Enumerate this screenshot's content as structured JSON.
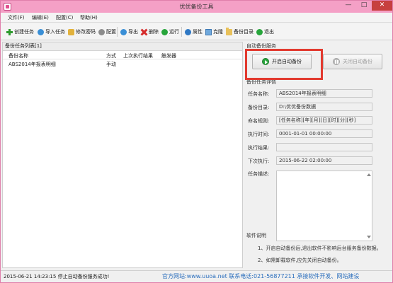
{
  "window": {
    "title": "优优备份工具",
    "min": "—",
    "max": "□",
    "close": "✕"
  },
  "menu": [
    {
      "label": "文件(F)"
    },
    {
      "label": "编辑(E)"
    },
    {
      "label": "配置(C)"
    },
    {
      "label": "帮助(H)"
    }
  ],
  "toolbar": [
    {
      "label": "创建任务",
      "icon": "plus-icon"
    },
    {
      "label": "导入任务",
      "icon": "import-icon"
    },
    {
      "label": "修改密码",
      "icon": "key-icon"
    },
    {
      "label": "配置",
      "icon": "gear-icon"
    },
    {
      "label": "导出",
      "icon": "export-icon"
    },
    {
      "label": "删除",
      "icon": "delete-icon"
    },
    {
      "label": "运行",
      "icon": "run-icon"
    },
    {
      "label": "属性",
      "icon": "info-icon"
    },
    {
      "label": "克隆",
      "icon": "clone-icon"
    },
    {
      "label": "备份目录",
      "icon": "folder-icon"
    },
    {
      "label": "退出",
      "icon": "exit-icon"
    }
  ],
  "task_list": {
    "title": "备份任务列表[1]",
    "columns": [
      "备份名称",
      "方式",
      "上次执行结果",
      "触发器"
    ],
    "rows": [
      {
        "name": "ABS2014年报表明细",
        "mode": "手动",
        "last_result": "",
        "trigger": ""
      }
    ]
  },
  "auto_backup": {
    "title": "自动备份服务",
    "start_label": "开启自动备份",
    "stop_label": "关闭自动备份"
  },
  "details": {
    "title": "备份任务详情",
    "fields": [
      {
        "label": "任务名称:",
        "value": "ABS2014年报表明细"
      },
      {
        "label": "备份目录:",
        "value": "D:\\优优备份数据"
      },
      {
        "label": "命名规则:",
        "value": "[任务名称][年][月][日][时][分][秒]"
      },
      {
        "label": "执行时间:",
        "value": "0001-01-01 00:00:00"
      },
      {
        "label": "执行结果:",
        "value": ""
      },
      {
        "label": "下次执行:",
        "value": "2015-06-22 02:00:00"
      }
    ],
    "desc_label": "任务描述:"
  },
  "software_notes": {
    "title": "软件说明",
    "lines": [
      "1、开启自动备份后,退出软件不影响后台服务备份数据。",
      "2、如需卸载软件,应先关闭自动备份。"
    ]
  },
  "status": {
    "text": "2015-06-21 14:23:15 停止自动备份服务成功!",
    "link": "官方网站:www.uuoa.net 联系电话:021-56877211 承接软件开发、网站建设"
  },
  "colors": {
    "titlebar": "#f4a0c6",
    "close": "#c7403f",
    "highlight": "#e23a2f",
    "link": "#2a6ebd"
  }
}
